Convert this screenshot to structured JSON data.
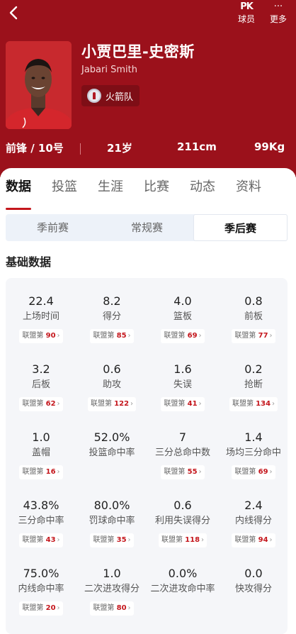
{
  "header": {
    "player_label": "球员",
    "more_label": "更多",
    "player_icon_text": "PK",
    "more_icon_text": "···",
    "name_cn": "小贾巴里-史密斯",
    "name_en": "Jabari Smith",
    "team": "火箭队",
    "position": "前锋 / 10号",
    "age": "21岁",
    "height": "211cm",
    "weight": "99Kg"
  },
  "tabs": [
    "数据",
    "投篮",
    "生涯",
    "比赛",
    "动态",
    "资料"
  ],
  "segments": [
    "季前赛",
    "常规赛",
    "季后赛"
  ],
  "active_segment": "季后赛",
  "section_title": "基础数据",
  "rank_prefix": "联盟第",
  "stats": [
    {
      "value": "22.4",
      "label": "上场时间",
      "rank": "90"
    },
    {
      "value": "8.2",
      "label": "得分",
      "rank": "85"
    },
    {
      "value": "4.0",
      "label": "篮板",
      "rank": "69"
    },
    {
      "value": "0.8",
      "label": "前板",
      "rank": "77"
    },
    {
      "value": "3.2",
      "label": "后板",
      "rank": "62"
    },
    {
      "value": "0.6",
      "label": "助攻",
      "rank": "122"
    },
    {
      "value": "1.6",
      "label": "失误",
      "rank": "41"
    },
    {
      "value": "0.2",
      "label": "抢断",
      "rank": "134"
    },
    {
      "value": "1.0",
      "label": "盖帽",
      "rank": "16"
    },
    {
      "value": "52.0%",
      "label": "投篮命中率",
      "rank": ""
    },
    {
      "value": "7",
      "label": "三分总命中数",
      "rank": "55"
    },
    {
      "value": "1.4",
      "label": "场均三分命中",
      "rank": "69"
    },
    {
      "value": "43.8%",
      "label": "三分命中率",
      "rank": "43"
    },
    {
      "value": "80.0%",
      "label": "罚球命中率",
      "rank": "35"
    },
    {
      "value": "0.6",
      "label": "利用失误得分",
      "rank": "118"
    },
    {
      "value": "2.4",
      "label": "内线得分",
      "rank": "94"
    },
    {
      "value": "75.0%",
      "label": "内线命中率",
      "rank": "20"
    },
    {
      "value": "1.0",
      "label": "二次进攻得分",
      "rank": "80"
    },
    {
      "value": "0.0%",
      "label": "二次进攻命中率",
      "rank": ""
    },
    {
      "value": "0.0",
      "label": "快攻得分",
      "rank": ""
    }
  ],
  "colors": {
    "brand": "#9b111b",
    "accent": "#c4161c"
  }
}
